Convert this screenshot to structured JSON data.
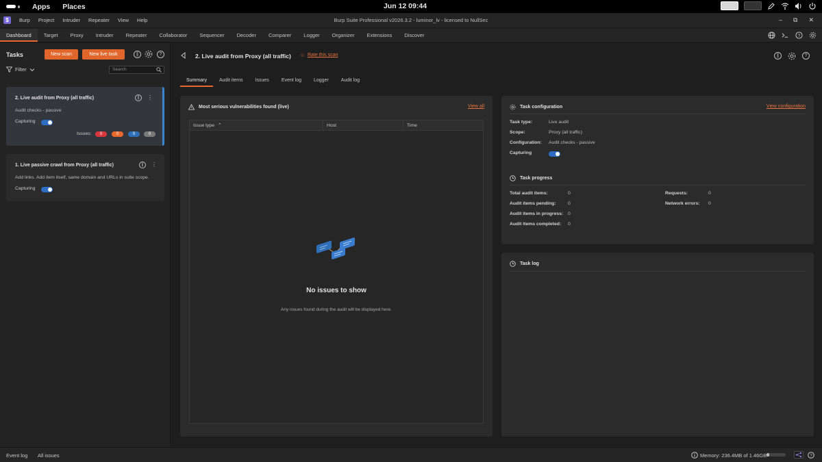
{
  "system": {
    "menus": [
      "Apps",
      "Places"
    ],
    "clock": "Jun 12  09:44"
  },
  "window": {
    "title": "Burp Suite Professional v2026.3.2 - luminor_lv - licensed to NullSec",
    "logo": "$",
    "menu": [
      "Burp",
      "Project",
      "Intruder",
      "Repeater",
      "View",
      "Help"
    ]
  },
  "tabs": [
    "Dashboard",
    "Target",
    "Proxy",
    "Intruder",
    "Repeater",
    "Collaborator",
    "Sequencer",
    "Decoder",
    "Comparer",
    "Logger",
    "Organizer",
    "Extensions",
    "Discover"
  ],
  "active_tab": "Dashboard",
  "tasks_panel": {
    "title": "Tasks",
    "new_scan": "New scan",
    "new_live_task": "New live task",
    "filter": "Filter",
    "search_placeholder": "Search",
    "tasks": [
      {
        "title": "2. Live audit from Proxy (all traffic)",
        "desc": "Audit checks - passive",
        "capturing": "Capturing",
        "issues_label": "Issues:",
        "issues": [
          "0",
          "0",
          "0",
          "0"
        ]
      },
      {
        "title": "1. Live passive crawl from Proxy (all traffic)",
        "desc": "Add links. Add item itself, same domain and URLs in suite scope.",
        "capturing": "Capturing"
      }
    ]
  },
  "main": {
    "title": "2. Live audit from Proxy (all traffic)",
    "rate": "Rate this scan",
    "subtabs": [
      "Summary",
      "Audit items",
      "Issues",
      "Event log",
      "Logger",
      "Audit log"
    ],
    "vulns": {
      "title": "Most serious vulnerabilities found (live)",
      "view_all": "View all",
      "columns": [
        "Issue type",
        "Host",
        "Time"
      ],
      "empty_title": "No issues to show",
      "empty_sub": "Any issues found during the audit will be displayed here."
    },
    "config": {
      "title": "Task configuration",
      "link": "View configuration",
      "rows": [
        {
          "label": "Task type:",
          "value": "Live audit"
        },
        {
          "label": "Scope:",
          "value": "Proxy (all traffic)"
        },
        {
          "label": "Configuration:",
          "value": "Audit checks - passive"
        }
      ],
      "capturing": "Capturing"
    },
    "progress": {
      "title": "Task progress",
      "left": [
        {
          "label": "Total audit items:",
          "value": "0"
        },
        {
          "label": "Audit items pending:",
          "value": "0"
        },
        {
          "label": "Audit items in progress:",
          "value": "0"
        },
        {
          "label": "Audit items completed:",
          "value": "0"
        }
      ],
      "right": [
        {
          "label": "Requests:",
          "value": "0"
        },
        {
          "label": "Network errors:",
          "value": "0"
        }
      ]
    },
    "tasklog": {
      "title": "Task log"
    }
  },
  "status": {
    "event_log": "Event log",
    "all_issues": "All issues",
    "memory": "Memory: 236.4MB of 1.46GB",
    "memory_fraction": 0.16
  },
  "colors": {
    "accent": "#e8692c",
    "toggle": "#2c6cc2",
    "badge_high": "#d9363e",
    "badge_medium": "#e8692c",
    "badge_low": "#2f6fb8",
    "badge_info": "#7a7a7a"
  }
}
